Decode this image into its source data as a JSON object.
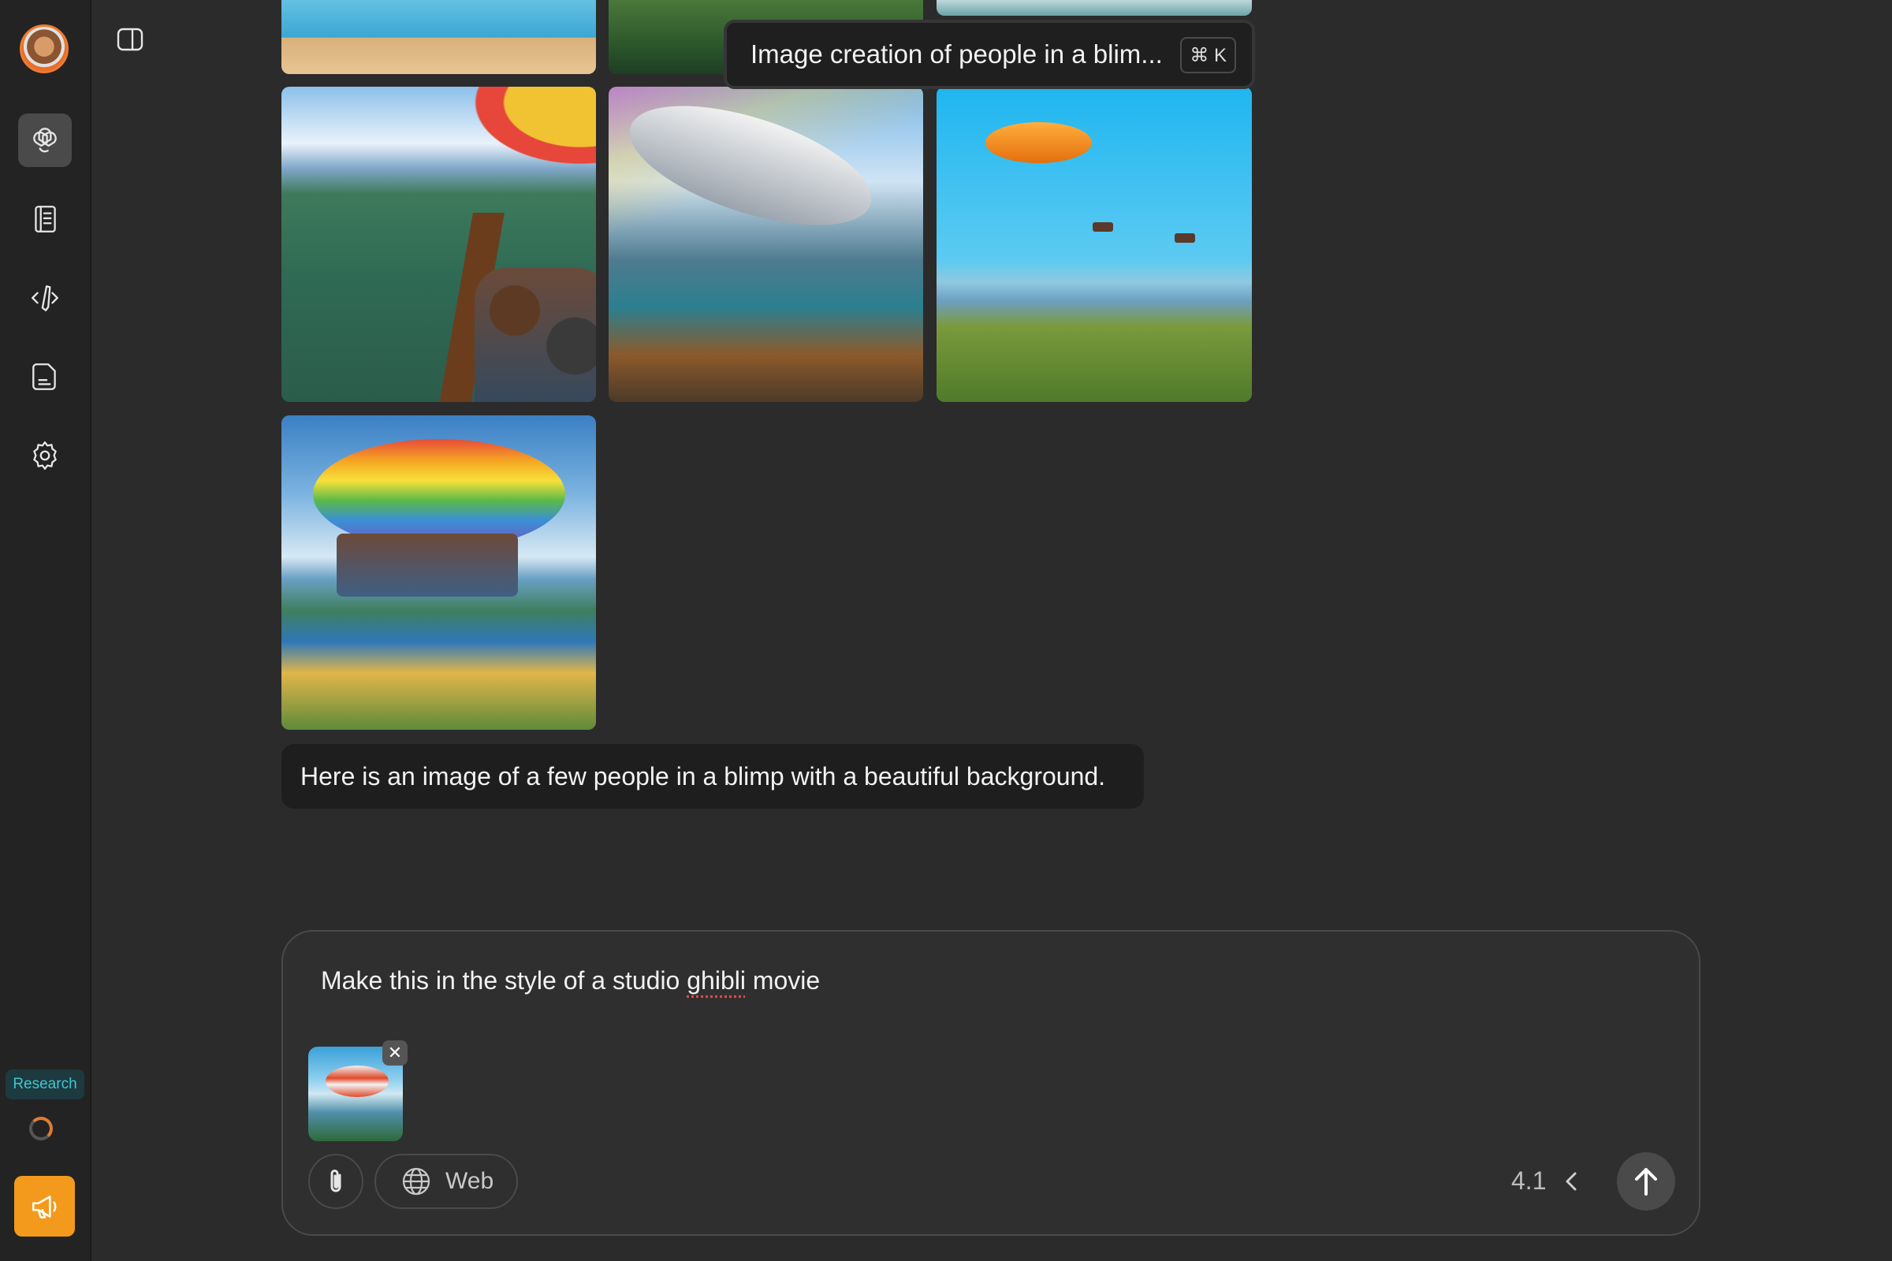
{
  "sidebar": {
    "items": [
      {
        "name": "openai-icon",
        "active": true
      },
      {
        "name": "notebook-icon",
        "active": false
      },
      {
        "name": "code-pen-icon",
        "active": false
      },
      {
        "name": "document-icon",
        "active": false
      },
      {
        "name": "settings-gear-icon",
        "active": false
      }
    ],
    "research_label": "Research"
  },
  "tooltip": {
    "text": "Image creation of people in a blim...",
    "shortcut": "⌘ K"
  },
  "assistant_message": {
    "text": "Here is an image of a few people in a blimp with a beautiful background."
  },
  "composer": {
    "text_before": "Make this in the style of a studio ",
    "text_misspelled": "ghibli",
    "text_after": " movie",
    "remove_label": "✕",
    "web_label": "Web",
    "model_version": "4.1"
  },
  "colors": {
    "background": "#2b2b2b",
    "sidebar": "#232323",
    "accent_orange": "#f39a1c",
    "research_teal": "#3ec7d3"
  }
}
